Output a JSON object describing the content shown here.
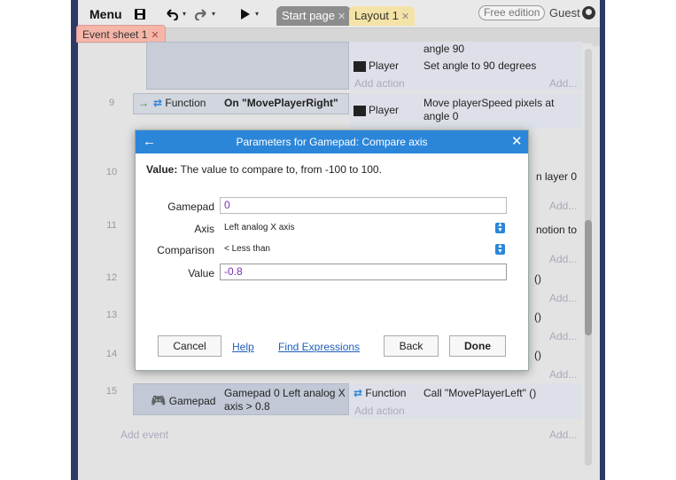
{
  "toolbar": {
    "menu_label": "Menu",
    "tabs": [
      {
        "label": "Start page"
      },
      {
        "label": "Layout 1"
      }
    ],
    "free_edition": "Free edition",
    "guest": "Guest"
  },
  "event_sheet_tab": "Event sheet 1",
  "events": {
    "row0": {
      "action_text1": "angle 90",
      "action_obj": "Player",
      "action_text2": "Set angle to 90 degrees",
      "add_action": "Add action",
      "dots": "Add..."
    },
    "row9": {
      "line": "9",
      "cond_obj": "Function",
      "cond_text": "On \"MovePlayerRight\"",
      "action_obj": "Player",
      "action_text": "Move playerSpeed pixels at angle 0"
    },
    "row10": {
      "line": "10",
      "action_tail": "n layer 0"
    },
    "row11": {
      "line": "11",
      "action_tail": "notion to"
    },
    "row12": {
      "line": "12",
      "tail": "()"
    },
    "row13": {
      "line": "13",
      "tail": "()"
    },
    "row14": {
      "line": "14",
      "tail": "()"
    },
    "row15": {
      "line": "15",
      "cond_obj": "Gamepad",
      "cond_text": "Gamepad 0 Left analog X axis > 0.8",
      "action_obj": "Function",
      "action_text": "Call \"MovePlayerLeft\" ()",
      "add_action": "Add action",
      "dots": "Add..."
    },
    "add_event": "Add event",
    "dots_generic": "Add..."
  },
  "dialog": {
    "title": "Parameters for Gamepad: Compare axis",
    "desc_label": "Value:",
    "desc_text": "The value to compare to, from -100 to 100.",
    "fields": {
      "gamepad": {
        "label": "Gamepad",
        "value": "0"
      },
      "axis": {
        "label": "Axis",
        "value": "Left analog X axis"
      },
      "comparison": {
        "label": "Comparison",
        "value": "< Less than"
      },
      "value": {
        "label": "Value",
        "value": "-0.8"
      }
    },
    "buttons": {
      "cancel": "Cancel",
      "help": "Help",
      "find": "Find Expressions",
      "back": "Back",
      "done": "Done"
    }
  },
  "colors": {
    "accent": "#2b86d9",
    "value_text": "#7a2fb0",
    "event_tab": "#f5b5a8"
  }
}
